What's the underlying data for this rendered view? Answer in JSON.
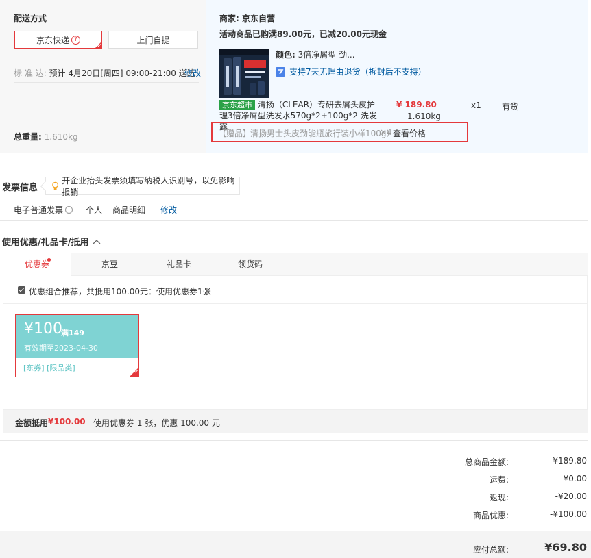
{
  "shipping": {
    "title": "配送方式",
    "options": [
      {
        "label": "京东快递",
        "selected": true
      },
      {
        "label": "上门自提",
        "selected": false
      }
    ],
    "help_glyph": "?",
    "std_label": "标 准 达:",
    "std_time": "预计 4月20日[周四] 09:00-21:00 送达",
    "modify": "修改",
    "weight_label": "总重量:",
    "weight_value": "1.610kg"
  },
  "order": {
    "merchant_label": "商家:",
    "merchant": "京东自营",
    "promo": "活动商品已购满89.00元，已减20.00元现金",
    "color_label": "颜色:",
    "color_value": "3倍净屑型 劲...",
    "return_policy": "支持7天无理由退货（拆封后不支持）",
    "store_tag": "京东超市",
    "product_line1": "清扬（CLEAR）专研去屑头皮护",
    "product_line2": "理3倍净屑型洗发水570g*2+100g*2 洗发露",
    "price": "¥ 189.80",
    "qty": "x1",
    "stock": "有货",
    "weight": "1.610kg",
    "gift_tag": "【赠品】",
    "gift_name": "清扬男士头皮劲能瓶旅行装小样100g）",
    "gift_qty": "×4",
    "gift_action": "查看价格"
  },
  "invoice": {
    "title": "发票信息",
    "tip": "开企业抬头发票须填写纳税人识别号，以免影响报销",
    "type": "电子普通发票",
    "info_glyph": "i",
    "holder": "个人",
    "content": "商品明细",
    "modify": "修改"
  },
  "discount": {
    "title": "使用优惠/礼品卡/抵用",
    "tabs": [
      "优惠券",
      "京豆",
      "礼品卡",
      "领货码"
    ],
    "combo_text": "优惠组合推荐，共抵用100.00元：使用优惠券1张",
    "coupon": {
      "amount": "¥100",
      "condition": "满149",
      "expire": "有效期至2023-04-30",
      "tags": "[东券] [限品类]"
    },
    "summary_label": "金额抵用",
    "summary_amount": "¥100.00",
    "summary_text": "使用优惠券 1 张，优惠 100.00 元"
  },
  "totals": {
    "rows": [
      {
        "label": "总商品金额:",
        "value": "¥189.80"
      },
      {
        "label": "运费:",
        "value": "¥0.00"
      },
      {
        "label": "返现:",
        "value": "-¥20.00"
      },
      {
        "label": "商品优惠:",
        "value": "-¥100.00"
      }
    ],
    "payable_label": "应付总额:",
    "payable_value": "¥69.80"
  },
  "colors": {
    "accent": "#e4393c",
    "link": "#005aa0",
    "coupon": "#7fd3d3",
    "store_tag": "#2aa147"
  }
}
